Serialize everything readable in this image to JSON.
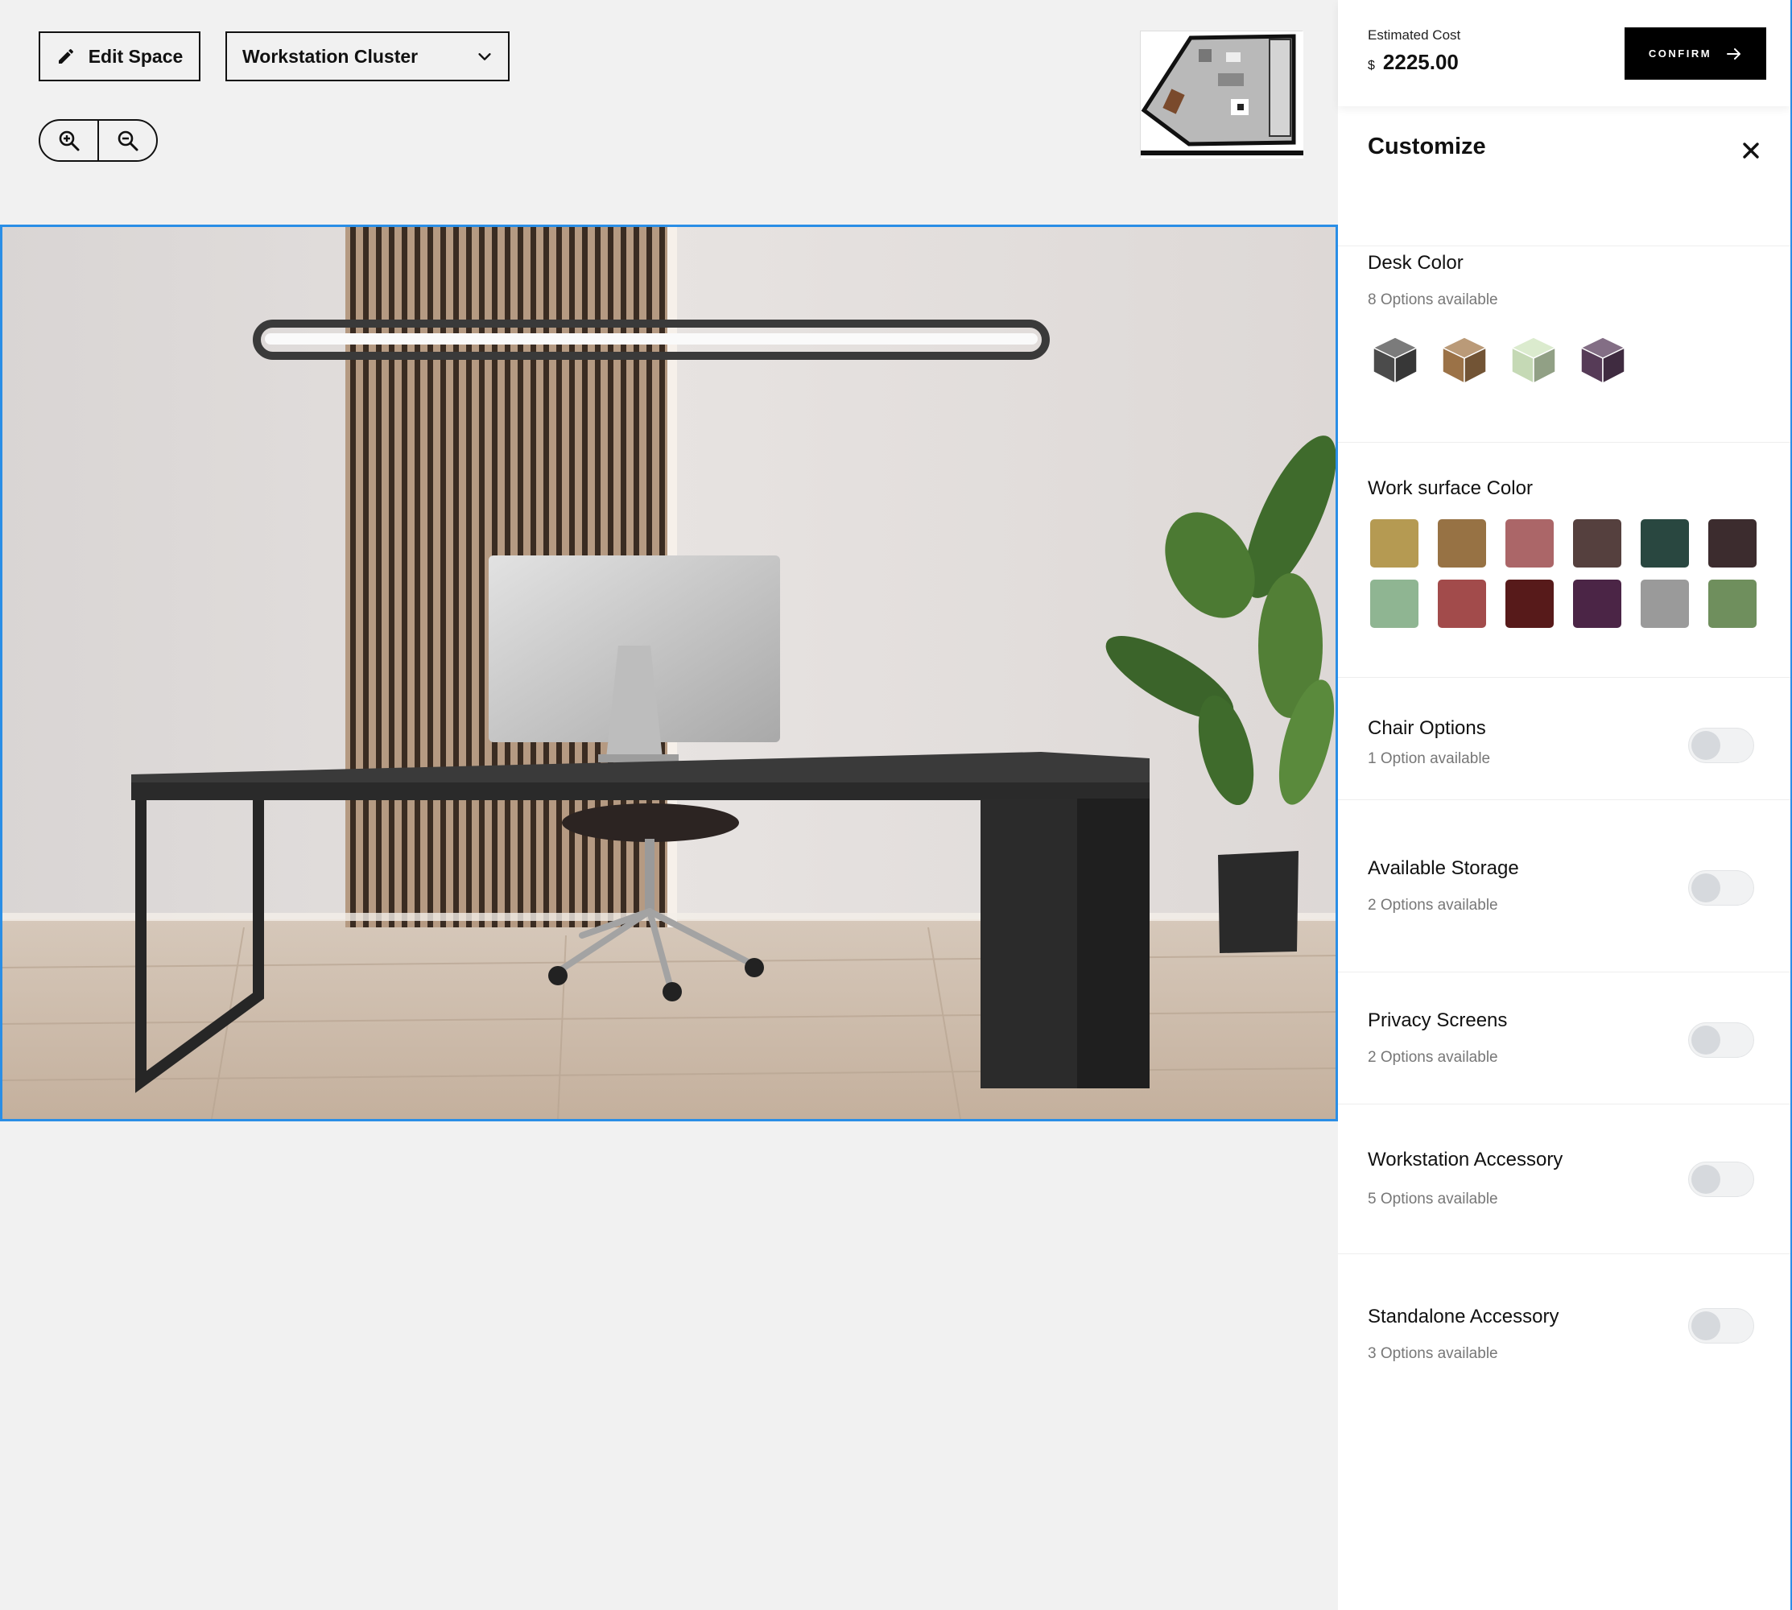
{
  "toolbar": {
    "edit_label": "Edit Space",
    "space_selected": "Workstation Cluster"
  },
  "cost": {
    "label": "Estimated Cost",
    "currency": "$",
    "amount": "2225.00",
    "confirm_label": "CONFIRM"
  },
  "customize": {
    "title": "Customize",
    "desk": {
      "title": "Desk Color",
      "subtitle": "8 Options available",
      "colors": [
        "#4f4f4f",
        "#a3784b",
        "#cfe4be",
        "#5a3e5c"
      ]
    },
    "work_surface": {
      "title": "Work surface Color",
      "colors": [
        "#b59a52",
        "#977244",
        "#ab6668",
        "#55403e",
        "#294740",
        "#3c2c2e",
        "#8fb592",
        "#a24b4b",
        "#571a1a",
        "#4b2546",
        "#9a9a9a",
        "#6f8f5d"
      ]
    },
    "chair": {
      "title": "Chair Options",
      "subtitle": "1 Option available",
      "enabled": false
    },
    "storage": {
      "title": "Available Storage",
      "subtitle": "2 Options available",
      "enabled": false
    },
    "privacy": {
      "title": "Privacy Screens",
      "subtitle": "2 Options available",
      "enabled": false
    },
    "ws_accessory": {
      "title": "Workstation Accessory",
      "subtitle": "5 Options available",
      "enabled": false
    },
    "standalone": {
      "title": "Standalone Accessory",
      "subtitle": "3 Options available",
      "enabled": false
    }
  },
  "icons": {
    "edit": "pencil-icon",
    "dropdown": "chevron-down-icon",
    "zoom_in": "zoom-in-icon",
    "zoom_out": "zoom-out-icon",
    "confirm_arrow": "arrow-right-icon",
    "close": "close-icon"
  },
  "colors": {
    "accent": "#2a8ee6",
    "confirm_bg": "#000000"
  }
}
